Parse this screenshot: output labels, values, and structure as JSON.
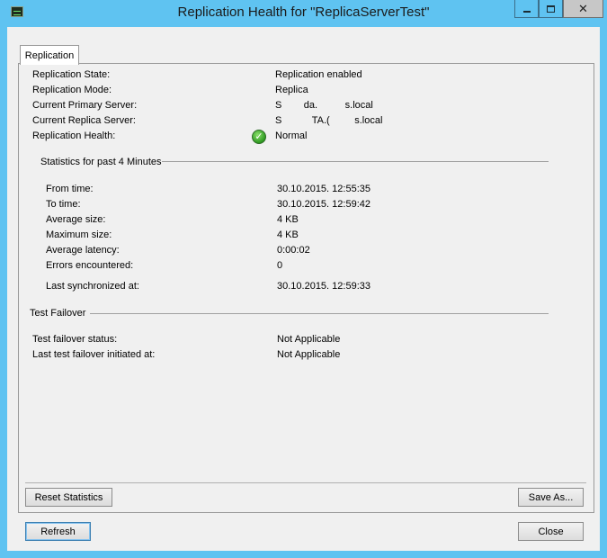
{
  "window": {
    "title": "Replication Health for \"ReplicaServerTest\"",
    "close_glyph": "✕"
  },
  "tab": {
    "label": "Replication"
  },
  "info": [
    {
      "label": "Replication State:",
      "value": "Replication enabled"
    },
    {
      "label": "Replication Mode:",
      "value": "Replica"
    },
    {
      "label": "Current Primary Server:",
      "value": "S        da.          s.local"
    },
    {
      "label": "Current Replica Server:",
      "value": "S           TA.(         s.local"
    },
    {
      "label": "Replication Health:",
      "value": "Normal",
      "icon": "check-icon"
    }
  ],
  "statistics": {
    "header": "Statistics for past 4 Minutes",
    "rows": [
      {
        "label": "From time:",
        "value": "30.10.2015. 12:55:35"
      },
      {
        "label": "To time:",
        "value": "30.10.2015. 12:59:42"
      },
      {
        "label": "Average size:",
        "value": "4 KB"
      },
      {
        "label": "Maximum size:",
        "value": "4 KB"
      },
      {
        "label": "Average latency:",
        "value": "0:00:02"
      },
      {
        "label": "Errors encountered:",
        "value": "0"
      }
    ],
    "last_sync": {
      "label": "Last synchronized at:",
      "value": "30.10.2015. 12:59:33"
    }
  },
  "test_failover": {
    "header": "Test Failover",
    "rows": [
      {
        "label": "Test failover status:",
        "value": "Not Applicable"
      },
      {
        "label": "Last test failover initiated at:",
        "value": "Not Applicable"
      }
    ]
  },
  "buttons": {
    "reset_statistics": "Reset Statistics",
    "save_as": "Save As...",
    "refresh": "Refresh",
    "close": "Close"
  }
}
